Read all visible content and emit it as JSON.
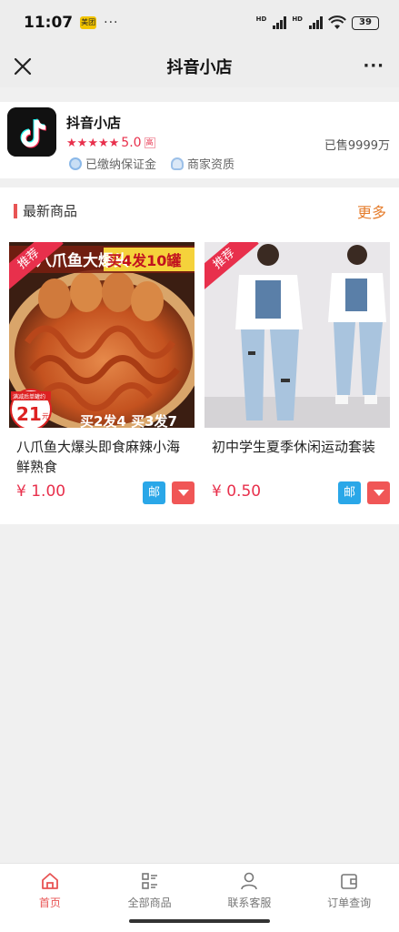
{
  "status_bar": {
    "time": "11:07",
    "app_badge": "美团",
    "dots": "···",
    "signal_1": "HD",
    "signal_2": "HD",
    "battery": "39"
  },
  "nav": {
    "title": "抖音小店",
    "more": "···"
  },
  "shop": {
    "name": "抖音小店",
    "rating": "5.0",
    "rating_tag": "高",
    "sold": "已售9999万",
    "badge_deposit": "已缴纳保证金",
    "badge_qualification": "商家资质"
  },
  "section": {
    "title": "最新商品",
    "more": "更多"
  },
  "products": [
    {
      "tag": "推荐",
      "image_text_top": "八爪鱼大爆头",
      "image_text_promo": "买4发10罐",
      "image_text_bottom": "买2发4 买3发7",
      "image_price_note": "满减后单罐约",
      "image_price": "21",
      "image_price_unit": "元",
      "name": "八爪鱼大爆头即食麻辣小海鲜熟食",
      "price": "¥ 1.00",
      "mail_label": "邮"
    },
    {
      "tag": "推荐",
      "name": "初中学生夏季休闲运动套装",
      "price": "¥ 0.50",
      "mail_label": "邮"
    }
  ],
  "tabs": [
    {
      "label": "首页",
      "icon": "home-icon",
      "active": true
    },
    {
      "label": "全部商品",
      "icon": "grid-list-icon",
      "active": false
    },
    {
      "label": "联系客服",
      "icon": "person-icon",
      "active": false
    },
    {
      "label": "订单查询",
      "icon": "wallet-icon",
      "active": false
    }
  ],
  "colors": {
    "accent_red": "#e8304c",
    "more_orange": "#e57c2b",
    "mail_blue": "#2aa7e8",
    "tab_active": "#e85454"
  }
}
